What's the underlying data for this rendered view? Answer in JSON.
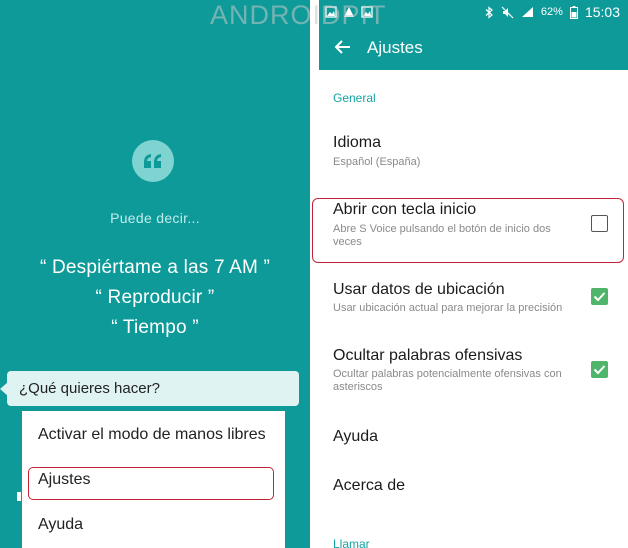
{
  "watermark": "ANDROIDPIT",
  "left_panel": {
    "hint_title": "Puede decir...",
    "commands": [
      "“ Despiértame a las 7 AM ”",
      "“ Reproducir ”",
      "“ Tiempo ”"
    ],
    "prompt": "¿Qué quieres hacer?",
    "menu_items": [
      "Activar el modo de manos libres",
      "Ajustes",
      "Ayuda"
    ],
    "colors": {
      "background": "#0f9a9a",
      "highlight": "#c2253b"
    }
  },
  "status_bar": {
    "battery": "62%",
    "time": "15:03"
  },
  "app_bar": {
    "title": "Ajustes"
  },
  "settings": {
    "section_general": "General",
    "items": [
      {
        "title": "Idioma",
        "subtitle": "Español (España)"
      },
      {
        "title": "Abrir con tecla inicio",
        "subtitle": "Abre S Voice pulsando el botón de inicio dos veces",
        "checked": false
      },
      {
        "title": "Usar datos de ubicación",
        "subtitle": "Usar ubicación actual para mejorar la precisión",
        "checked": true
      },
      {
        "title": "Ocultar palabras ofensivas",
        "subtitle": "Ocultar palabras potencialmente ofensivas con asteriscos",
        "checked": true
      },
      {
        "title": "Ayuda"
      },
      {
        "title": "Acerca de"
      }
    ],
    "section_call": "Llamar"
  }
}
